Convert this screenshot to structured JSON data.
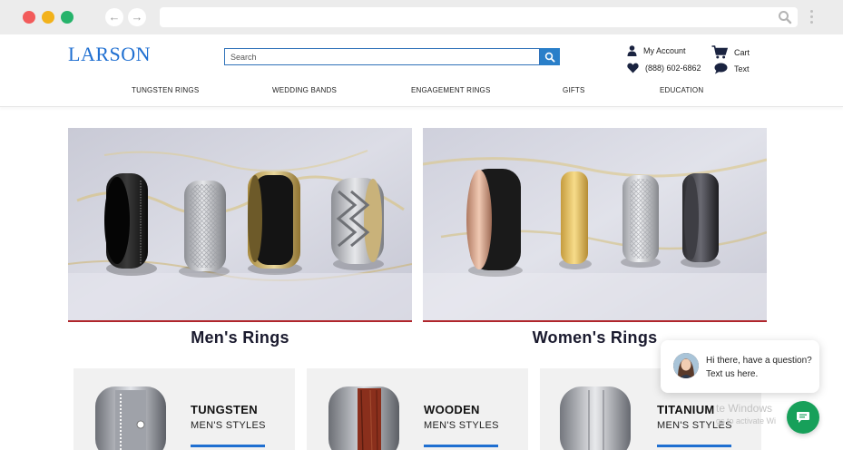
{
  "browser": {
    "back_glyph": "←",
    "forward_glyph": "→",
    "url": ""
  },
  "header": {
    "logo": "LARSON",
    "search": {
      "placeholder": "Search",
      "value": ""
    },
    "account_label": "My Account",
    "phone_label": "(888) 602-6862",
    "cart_label": "Cart",
    "text_label": "Text",
    "accent_color": "#1f6fd1"
  },
  "nav": {
    "items": [
      {
        "label": "TUNGSTEN RINGS"
      },
      {
        "label": "WEDDING BANDS"
      },
      {
        "label": "ENGAGEMENT RINGS"
      },
      {
        "label": "GIFTS"
      },
      {
        "label": "EDUCATION"
      }
    ]
  },
  "heroes": [
    {
      "title": "Men's Rings"
    },
    {
      "title": "Women's Rings"
    }
  ],
  "categories": [
    {
      "title": "TUNGSTEN",
      "subtitle": "MEN'S STYLES"
    },
    {
      "title": "WOODEN",
      "subtitle": "MEN'S STYLES"
    },
    {
      "title": "TITANIUM",
      "subtitle": "MEN'S STYLES"
    }
  ],
  "watermark": {
    "line1": "te Windows",
    "line2": "gs to activate Wi"
  },
  "chat": {
    "message": "Hi there, have a question? Text us here."
  },
  "icons": {
    "account": "user-icon",
    "phone": "heart-icon",
    "cart": "cart-icon",
    "text": "chat-bubble-icon",
    "search": "search-icon",
    "chat_launcher": "message-icon"
  }
}
